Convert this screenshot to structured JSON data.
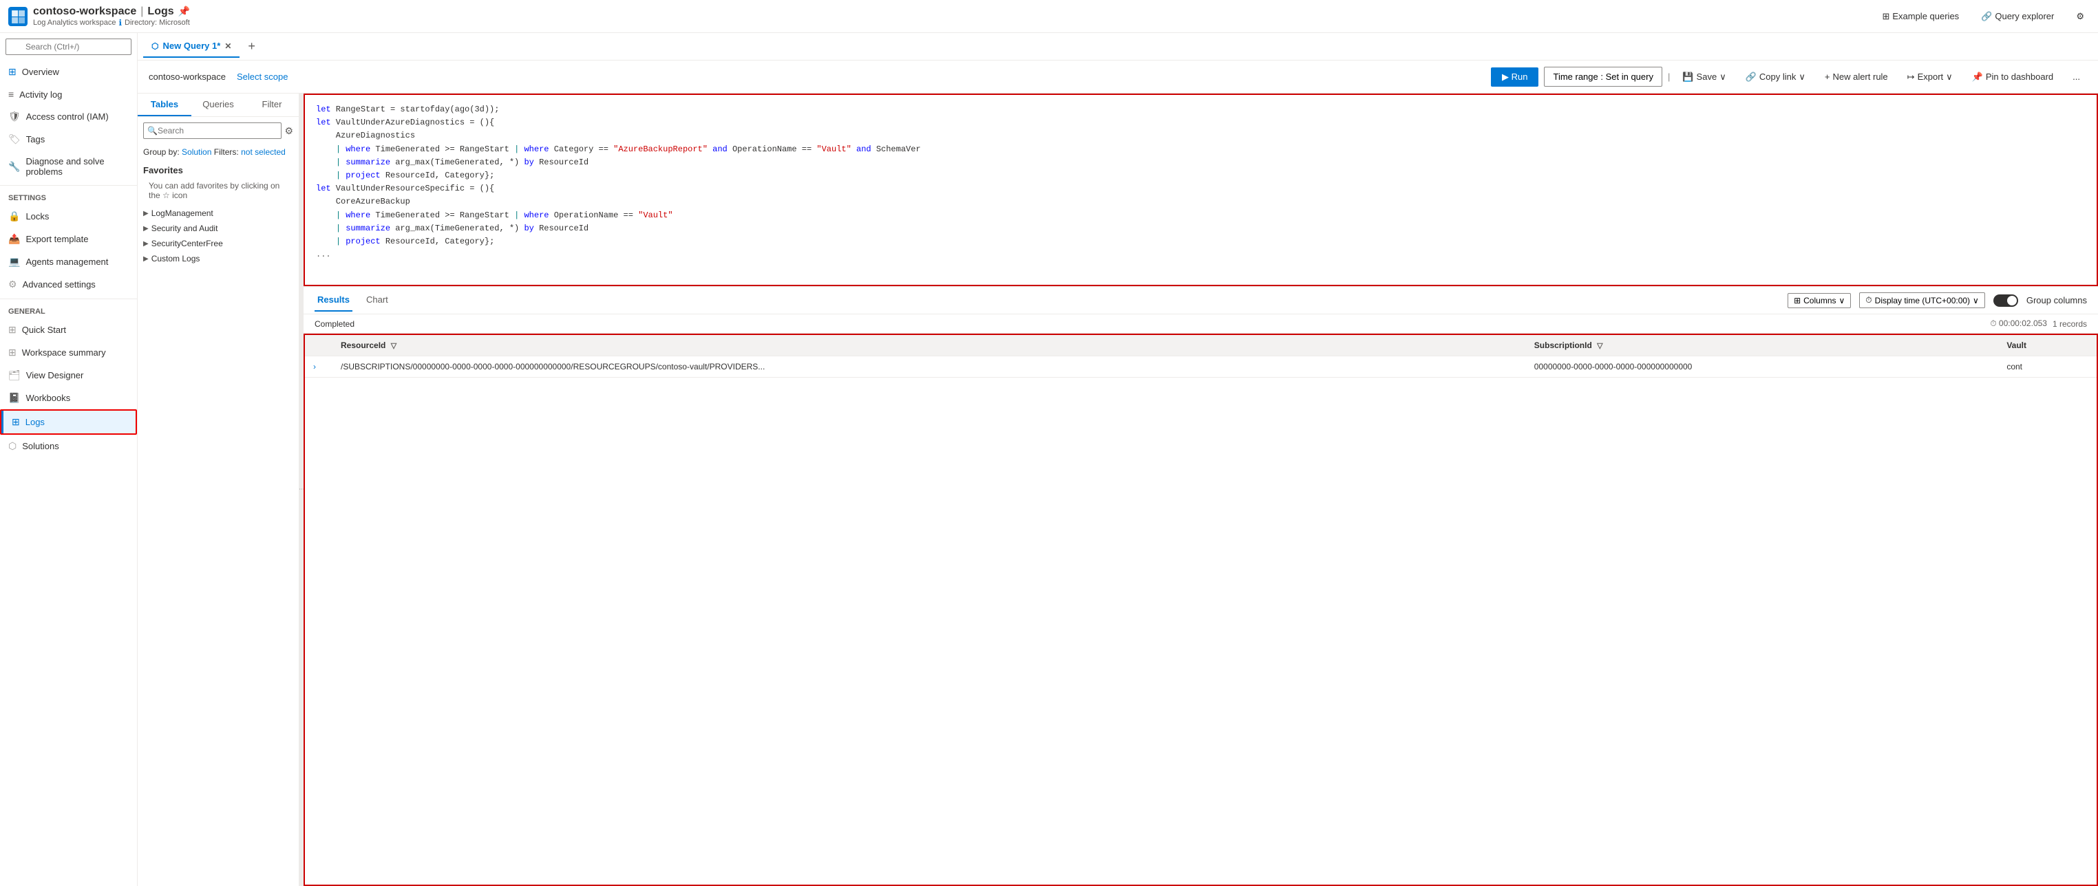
{
  "header": {
    "logo_label": "Azure",
    "workspace": "contoso-workspace",
    "separator": "|",
    "page_title": "Logs",
    "pin_icon": "📌",
    "subtitle_workspace": "Log Analytics workspace",
    "info_icon": "ℹ",
    "directory": "Directory: Microsoft",
    "actions": {
      "example_queries": "Example queries",
      "query_explorer": "Query explorer",
      "settings": "⚙"
    }
  },
  "sidebar": {
    "search_placeholder": "Search (Ctrl+/)",
    "nav_items": [
      {
        "id": "overview",
        "label": "Overview",
        "icon": "grid"
      },
      {
        "id": "activity-log",
        "label": "Activity log",
        "icon": "list"
      },
      {
        "id": "access-control",
        "label": "Access control (IAM)",
        "icon": "shield"
      },
      {
        "id": "tags",
        "label": "Tags",
        "icon": "tag"
      },
      {
        "id": "diagnose",
        "label": "Diagnose and solve problems",
        "icon": "wrench"
      }
    ],
    "settings_section": "Settings",
    "settings_items": [
      {
        "id": "locks",
        "label": "Locks",
        "icon": "lock"
      },
      {
        "id": "export-template",
        "label": "Export template",
        "icon": "export"
      },
      {
        "id": "agents-management",
        "label": "Agents management",
        "icon": "agents"
      },
      {
        "id": "advanced-settings",
        "label": "Advanced settings",
        "icon": "settings"
      }
    ],
    "general_section": "General",
    "general_items": [
      {
        "id": "quick-start",
        "label": "Quick Start",
        "icon": "rocket"
      },
      {
        "id": "workspace-summary",
        "label": "Workspace summary",
        "icon": "grid"
      },
      {
        "id": "view-designer",
        "label": "View Designer",
        "icon": "view"
      },
      {
        "id": "workbooks",
        "label": "Workbooks",
        "icon": "book"
      },
      {
        "id": "logs",
        "label": "Logs",
        "icon": "logs",
        "active": true
      },
      {
        "id": "solutions",
        "label": "Solutions",
        "icon": "solutions"
      }
    ]
  },
  "tab_bar": {
    "active_tab": "New Query 1*",
    "add_tab": "+"
  },
  "workspace_bar": {
    "workspace_name": "contoso-workspace",
    "select_scope": "Select scope",
    "run_label": "▶ Run",
    "time_range": "Time range :  Set in query",
    "save_label": "Save",
    "copy_link": "Copy link",
    "new_alert": "New alert rule",
    "export": "Export",
    "pin_dashboard": "Pin to dashboard",
    "more": "..."
  },
  "left_panel": {
    "tabs": [
      "Tables",
      "Queries",
      "Filter"
    ],
    "search_placeholder": "Search",
    "group_by_label": "Group by:",
    "group_by_value": "Solution",
    "filters_label": "Filters:",
    "filters_value": "not selected",
    "favorites_title": "Favorites",
    "favorites_hint": "You can add favorites by clicking on the ☆ icon",
    "tree_items": [
      {
        "label": "LogManagement"
      },
      {
        "label": "Security and Audit"
      },
      {
        "label": "SecurityCenterFree"
      },
      {
        "label": "Custom Logs"
      }
    ]
  },
  "query_editor": {
    "lines": [
      "let RangeStart = startofday(ago(3d));",
      "let VaultUnderAzureDiagnostics = (){",
      "    AzureDiagnostics",
      "    | where TimeGenerated >= RangeStart | where Category == \"AzureBackupReport\" and OperationName == \"Vault\" and SchemaVer",
      "    | summarize arg_max(TimeGenerated, *) by ResourceId",
      "    | project ResourceId, Category};",
      "let VaultUnderResourceSpecific = (){",
      "    CoreAzureBackup",
      "    | where TimeGenerated >= RangeStart | where OperationName == \"Vault\"",
      "    | summarize arg_max(TimeGenerated, *) by ResourceId",
      "    | project ResourceId, Category};"
    ]
  },
  "results": {
    "tabs": [
      "Results",
      "Chart"
    ],
    "columns_btn": "Columns",
    "display_time": "Display time (UTC+00:00)",
    "group_columns": "Group columns",
    "status": "Completed",
    "elapsed_time": "⏱ 00:00:02.053",
    "records_count": "1 records",
    "table_headers": [
      "ResourceId",
      "SubscriptionId",
      "Vault"
    ],
    "table_row": {
      "expand_icon": "›",
      "resource_id": "/SUBSCRIPTIONS/00000000-0000-0000-0000-000000000000/RESOURCEGROUPS/contoso-vault/PROVIDERS...",
      "subscription_id": "00000000-0000-0000-0000-000000000000",
      "vault": "cont"
    }
  }
}
